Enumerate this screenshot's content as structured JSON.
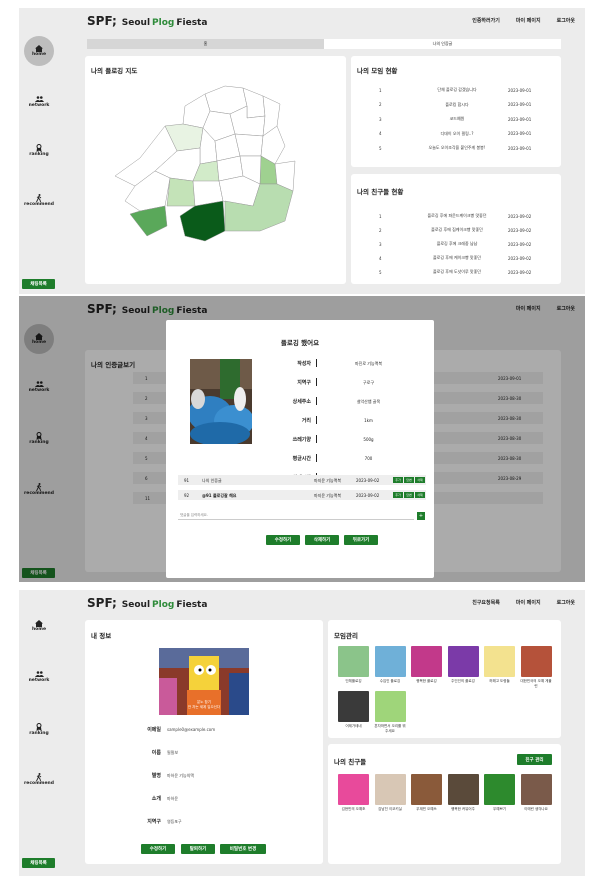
{
  "brand": {
    "logo_mark": "SPF;",
    "name_1": "Seoul",
    "name_2": "Plog",
    "name_3": "Fiesta"
  },
  "sidebar": {
    "home": "home",
    "network": "network",
    "ranking": "ranking",
    "recommend": "recommend",
    "chat_button": "채팅목록"
  },
  "panel1": {
    "nav": [
      "인증하러가기",
      "마이 페이지",
      "로그아웃"
    ],
    "tabs": [
      "홈",
      "나의 인증글"
    ],
    "map_title": "나의 플로깅 지도",
    "meetings_title": "나의 모임 현황",
    "meetings": [
      {
        "no": "1",
        "title": "단체 플로깅 갑겠습니다",
        "date": "2023-09-01"
      },
      {
        "no": "2",
        "title": "플로킹 합시다",
        "date": "2023-09-01"
      },
      {
        "no": "3",
        "title": "코드예원",
        "date": "2023-09-01"
      },
      {
        "no": "4",
        "title": "디데이 오이 필링..?",
        "date": "2023-09-01"
      },
      {
        "no": "5",
        "title": "오늘도 오이조각을 붙인주게 봉봉!",
        "date": "2023-09-01"
      }
    ],
    "friends_title": "나의 친구들 현황",
    "friend_posts": [
      {
        "no": "1",
        "title": "플로깅 후에 파운드케이크빵 맛좋던",
        "date": "2023-09-02"
      },
      {
        "no": "2",
        "title": "플로깅 후에 집케이크빵 맛좋던",
        "date": "2023-09-02"
      },
      {
        "no": "3",
        "title": "플로깅 후에 크레중 냠냠",
        "date": "2023-09-02"
      },
      {
        "no": "4",
        "title": "플로깅 후에 케이크빵 맛좋던",
        "date": "2023-09-02"
      },
      {
        "no": "5",
        "title": "플로깅 후에 도넛이루 맛좋던",
        "date": "2023-09-02"
      }
    ],
    "district_shades": [
      "#ffffff",
      "#ffffff",
      "#ffffff",
      "#ffffff",
      "#ffffff",
      "#ffffff",
      "#e8f3e3",
      "#ffffff",
      "#ffffff",
      "#ffffff",
      "#ffffff",
      "#9fd190",
      "#ffffff",
      "#ffffff",
      "#d2ebc9",
      "#ffffff",
      "#ffffff",
      "#ffffff",
      "#ffffff",
      "#5aa85a",
      "#c4e3b8",
      "#ffffff",
      "#ffffff",
      "#0a5b1a",
      "#b8ddb0"
    ]
  },
  "panel2": {
    "nav": [
      "마이 페이지",
      "로그아웃"
    ],
    "bg_title": "나의 인증글보기",
    "bg_rows": [
      {
        "no": "1",
        "date": "2023-09-01"
      },
      {
        "no": "2",
        "date": "2023-08-30"
      },
      {
        "no": "3",
        "date": "2023-08-30"
      },
      {
        "no": "4",
        "date": "2023-08-30"
      },
      {
        "no": "5",
        "date": "2023-08-30"
      },
      {
        "no": "6",
        "date": "2023-08-29"
      },
      {
        "no": "11",
        "date": ""
      }
    ],
    "pagination": "1",
    "modal": {
      "title": "플로깅 했어요",
      "fields": [
        {
          "label": "작성자",
          "value": "마진로 기능맥북"
        },
        {
          "label": "지역구",
          "value": "구로구"
        },
        {
          "label": "상세주소",
          "value": "설악산뱀 골목"
        },
        {
          "label": "거리",
          "value": "1km"
        },
        {
          "label": "쓰레기양",
          "value": "500g"
        },
        {
          "label": "평균시간",
          "value": "700"
        },
        {
          "label": "상세시간",
          "value": "14:03~15:00"
        }
      ],
      "comments": [
        {
          "no": "91",
          "text": "나의 인증글",
          "author": "마지윤 기능맥북",
          "date": "2023-09-02",
          "bold": false
        },
        {
          "no": "92",
          "text": "@91 플로깅잘 해요",
          "author": "마지윤 기능맥북",
          "date": "2023-09-02",
          "bold": true
        }
      ],
      "comment_btns": [
        "추가",
        "답변",
        "삭제"
      ],
      "comment_placeholder": "댓글을 입력하세요.",
      "add_btn": "+",
      "actions": [
        "수정하기",
        "삭제하기",
        "뒤로가기"
      ]
    }
  },
  "panel3": {
    "nav": [
      "친구요청목록",
      "마이 페이지",
      "로그아웃"
    ],
    "info_title": "내 정보",
    "photo_caption": "분노 참기\n안 자는 세계 입으신다",
    "fields": [
      {
        "label": "이메일",
        "value": "sample0@example.com"
      },
      {
        "label": "이름",
        "value": "필필보"
      },
      {
        "label": "별명",
        "value": "마하윤 기능의맥"
      },
      {
        "label": "소개",
        "value": "마하윤"
      },
      {
        "label": "지역구",
        "value": "영등포구"
      }
    ],
    "actions": [
      "수정하기",
      "탈퇴하기",
      "비밀번호 변경"
    ],
    "group_title": "모임관리",
    "groups": [
      {
        "label": "단체플로깅",
        "color": "#8bc48a"
      },
      {
        "label": "수입인 플로깅",
        "color": "#6fb0d8"
      },
      {
        "label": "행복한 플로깅",
        "color": "#c2398a"
      },
      {
        "label": "주인인의 플로깅",
        "color": "#7b3aa8"
      },
      {
        "label": "허해고 도령들",
        "color": "#f3e28f"
      },
      {
        "label": "대한민국의 오예 게불린",
        "color": "#b5523a"
      },
      {
        "label": "어제가테네",
        "color": "#3a3a3a"
      },
      {
        "label": "혼자하면서 오리를 뭐주세요",
        "color": "#9fd57a"
      }
    ],
    "friends_title": "나의 친구들",
    "friend_btn": "친구 관리",
    "friends": [
      {
        "label": "김현민의 오예조",
        "color": "#e84a9b"
      },
      {
        "label": "김남진 이코키실",
        "color": "#d8c7b5"
      },
      {
        "label": "우재민 오예쓰",
        "color": "#8a5a3a"
      },
      {
        "label": "행복한 커뮤어주",
        "color": "#5a4a3a"
      },
      {
        "label": "우예쁘기",
        "color": "#2d8a2d"
      },
      {
        "label": "이에린 생각나요",
        "color": "#7a5a4a"
      }
    ]
  }
}
